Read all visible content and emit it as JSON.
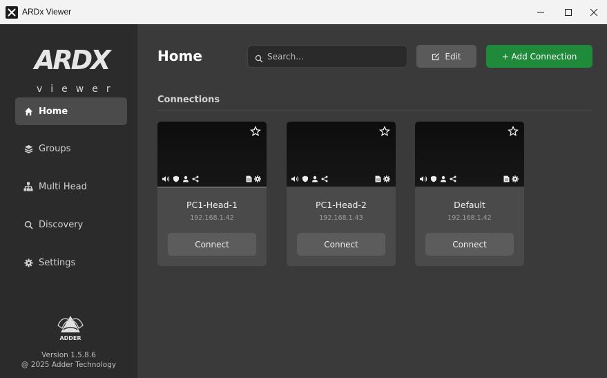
{
  "window": {
    "title": "ARDx Viewer"
  },
  "sidebar": {
    "logo_word": "ARDX",
    "logo_sub": "viewer",
    "items": [
      {
        "label": "Home",
        "icon": "home-icon",
        "active": true
      },
      {
        "label": "Groups",
        "icon": "layers-icon",
        "active": false
      },
      {
        "label": "Multi Head",
        "icon": "hierarchy-icon",
        "active": false
      },
      {
        "label": "Discovery",
        "icon": "search-icon",
        "active": false
      },
      {
        "label": "Settings",
        "icon": "gear-icon",
        "active": false
      }
    ],
    "brand": "ADDER",
    "version": "Version 1.5.8.6",
    "copyright": "@ 2025 Adder Technology"
  },
  "main": {
    "title": "Home",
    "search_placeholder": "Search...",
    "edit_label": "Edit",
    "add_label": "+ Add Connection",
    "section_title": "Connections",
    "connections": [
      {
        "name": "PC1-Head-1",
        "ip": "192.168.1.42",
        "button": "Connect"
      },
      {
        "name": "PC1-Head-2",
        "ip": "192.168.1.43",
        "button": "Connect"
      },
      {
        "name": "Default",
        "ip": "192.168.1.42",
        "button": "Connect"
      }
    ]
  },
  "colors": {
    "sidebar_bg": "#2b2b2b",
    "main_bg": "#3a3a3a",
    "card_bg": "#4a4a4a",
    "accent_green": "#1f8a3a"
  }
}
